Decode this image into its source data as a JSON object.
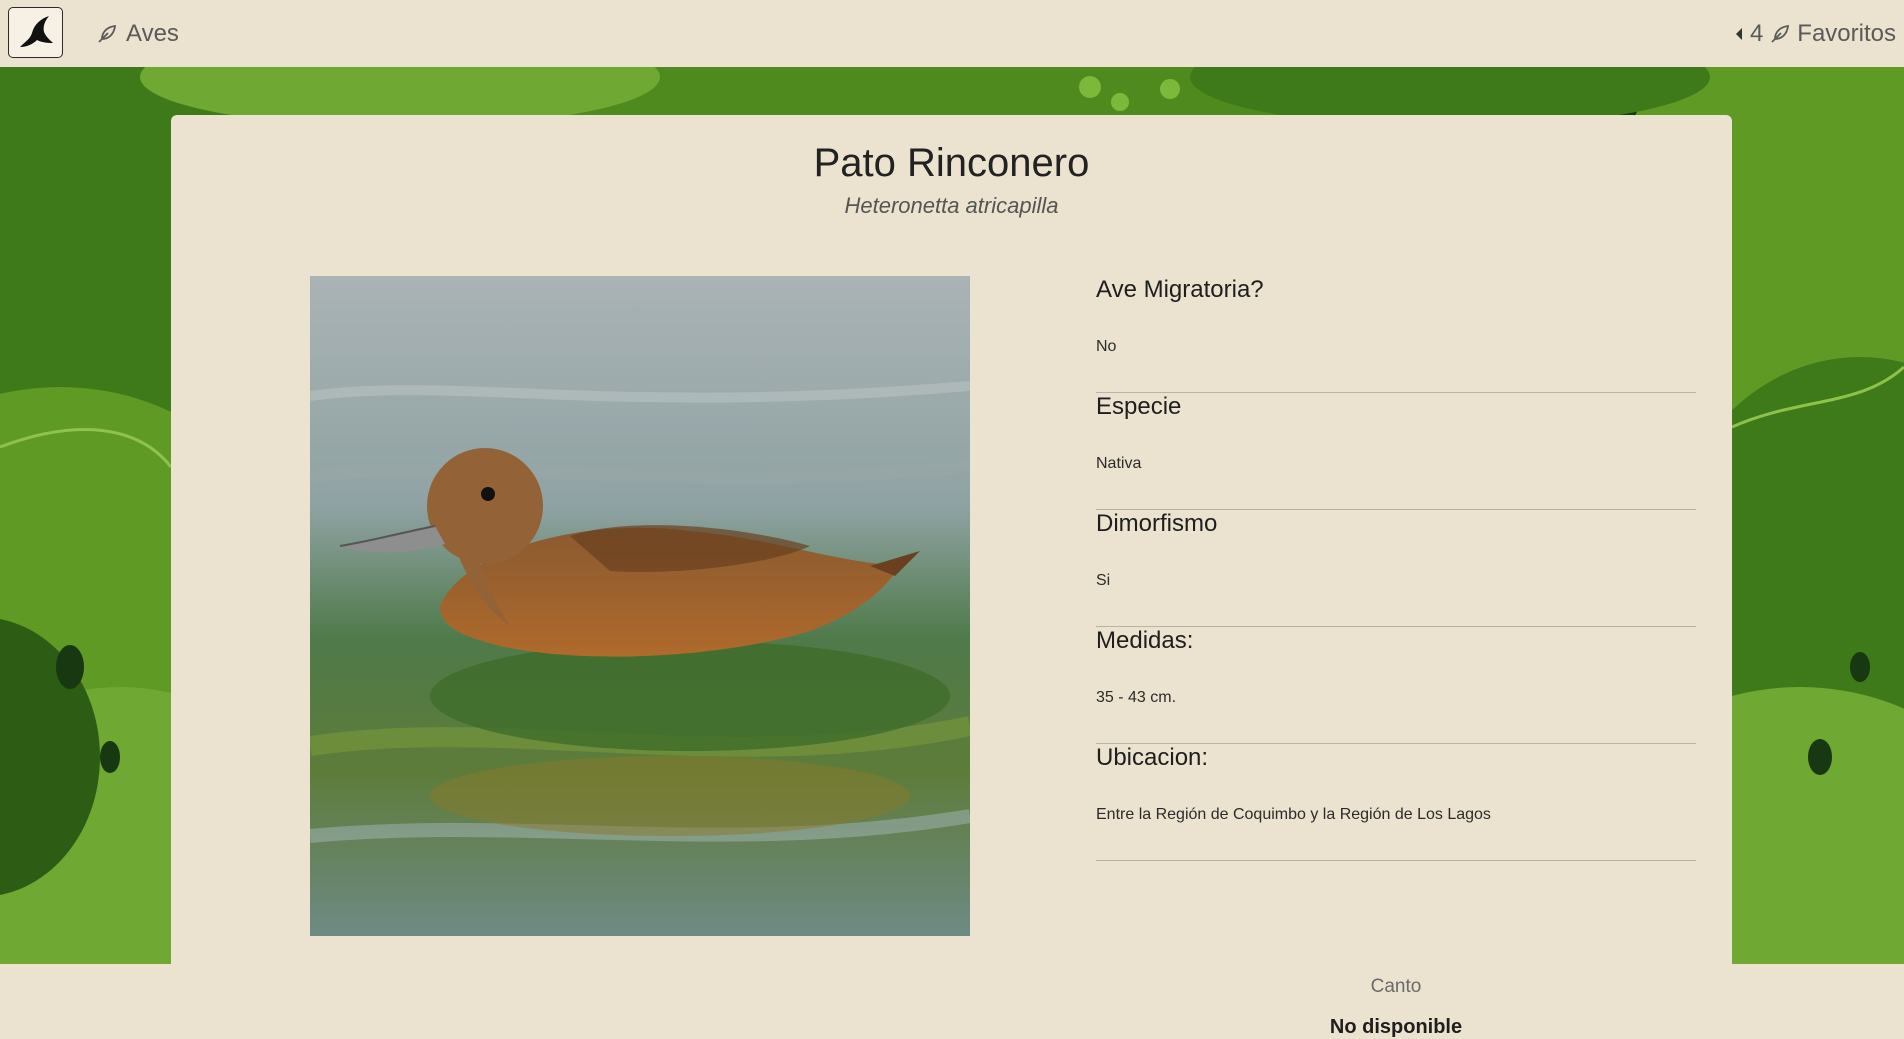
{
  "nav": {
    "aves_label": "Aves",
    "favorites_count": "4",
    "favorites_label": "Favoritos"
  },
  "bird": {
    "name": "Pato Rinconero",
    "scientific_name": "Heteronetta atricapilla",
    "photo_icon": "duck-photo"
  },
  "info": {
    "items": [
      {
        "label": "Ave Migratoria?",
        "value": "No"
      },
      {
        "label": "Especie",
        "value": "Nativa"
      },
      {
        "label": "Dimorfismo",
        "value": "Si"
      },
      {
        "label": "Medidas:",
        "value": "35 - 43 cm."
      },
      {
        "label": "Ubicacion:",
        "value": "Entre la Región de Coquimbo y la Región de Los Lagos"
      }
    ],
    "canto_label": "Canto",
    "canto_value": "No disponible"
  },
  "colors": {
    "page_bg": "#ebe3cf",
    "leaf_dark": "#1f4a12",
    "leaf_light": "#6fa832"
  }
}
